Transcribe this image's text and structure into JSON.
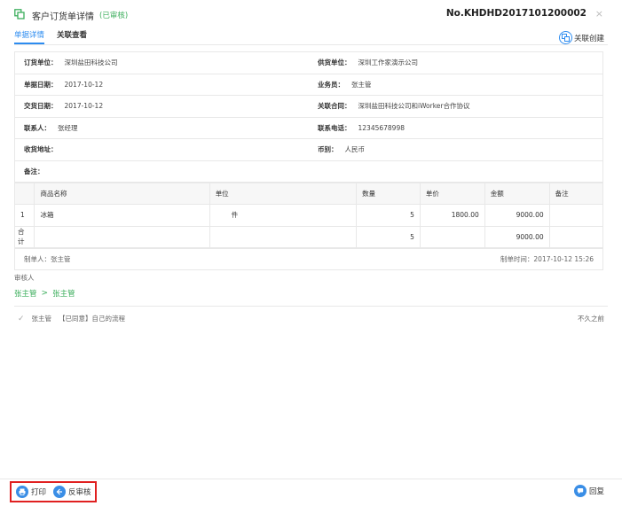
{
  "colors": {
    "accent": "#2d8cf0",
    "status_green": "#3cae5c",
    "highlight_red": "#e02020"
  },
  "header": {
    "icon": "copy-icon",
    "title": "客户订货单详情",
    "status": "(已审核)",
    "order_no": "No.KHDHD2017101200002",
    "close": "×"
  },
  "tabs": [
    {
      "label": "单据详情"
    },
    {
      "label": "关联查看"
    }
  ],
  "link_create": {
    "label": "关联创建",
    "icon": "link-create-icon"
  },
  "info": {
    "rows": [
      [
        {
          "label": "订货单位：",
          "value": "深圳盐田科技公司"
        },
        {
          "label": "供货单位：",
          "value": "深圳工作家演示公司"
        }
      ],
      [
        {
          "label": "单据日期：",
          "value": "2017-10-12"
        },
        {
          "label": "业务员：",
          "value": "张主管"
        }
      ],
      [
        {
          "label": "交货日期：",
          "value": "2017-10-12"
        },
        {
          "label": "关联合同：",
          "value": "深圳盐田科技公司和iWorker合作协议"
        }
      ],
      [
        {
          "label": "联系人：",
          "value": "张经理"
        },
        {
          "label": "联系电话：",
          "value": "12345678998"
        }
      ],
      [
        {
          "label": "收货地址：",
          "value": ""
        },
        {
          "label": "币别：",
          "value": "人民币"
        }
      ]
    ],
    "remark_label": "备注："
  },
  "items_table": {
    "headers": [
      "",
      "商品名称",
      "单位",
      "数量",
      "单价",
      "金额",
      "备注"
    ],
    "rows": [
      {
        "idx": "1",
        "name": "冰箱",
        "unit": "件",
        "qty": "5",
        "price": "1800.00",
        "amount": "9000.00",
        "note": ""
      }
    ],
    "total": {
      "label": "合计",
      "qty": "5",
      "amount": "9000.00"
    }
  },
  "footer": {
    "creator": "制单人：张主管",
    "created_time": "制单时间：2017-10-12 15:26"
  },
  "approver": {
    "label": "审核人",
    "chain": [
      "张主管",
      "张主管"
    ],
    "separator": ">"
  },
  "flow": {
    "user": "张主管",
    "action": "【已同意】自己的流程",
    "time": "不久之前"
  },
  "actions": {
    "print": "打印",
    "unaudit": "反审核",
    "reply": "回复"
  }
}
